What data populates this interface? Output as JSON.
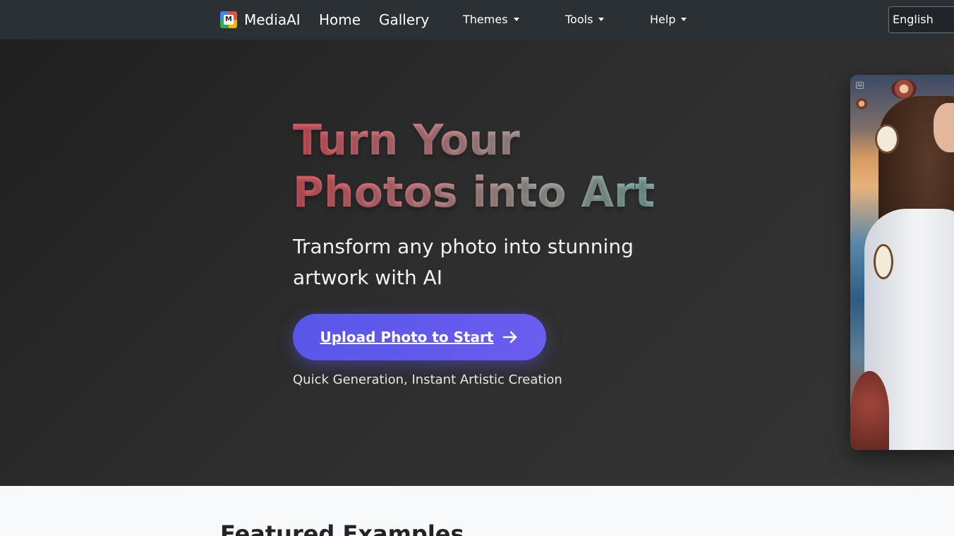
{
  "navbar": {
    "brand": "MediaAI",
    "links": [
      {
        "label": "Home"
      },
      {
        "label": "Gallery"
      }
    ],
    "dropdowns": [
      {
        "label": "Themes"
      },
      {
        "label": "Tools"
      },
      {
        "label": "Help"
      }
    ],
    "language": "English"
  },
  "hero": {
    "title_line1": "Turn Your",
    "title_line2": "Photos into Art",
    "subtitle": "Transform any photo into stunning artwork with AI",
    "cta_label": "Upload Photo to Start",
    "note": "Quick Generation, Instant Artistic Creation",
    "image_badge": "AI"
  },
  "featured": {
    "title": "Featured Examples"
  },
  "colors": {
    "navbar_bg": "#2b3035",
    "cta_accent": "#5856e8",
    "title_gradient": [
      "#e05c66",
      "#a9a5a1",
      "#7bb6ad"
    ]
  }
}
